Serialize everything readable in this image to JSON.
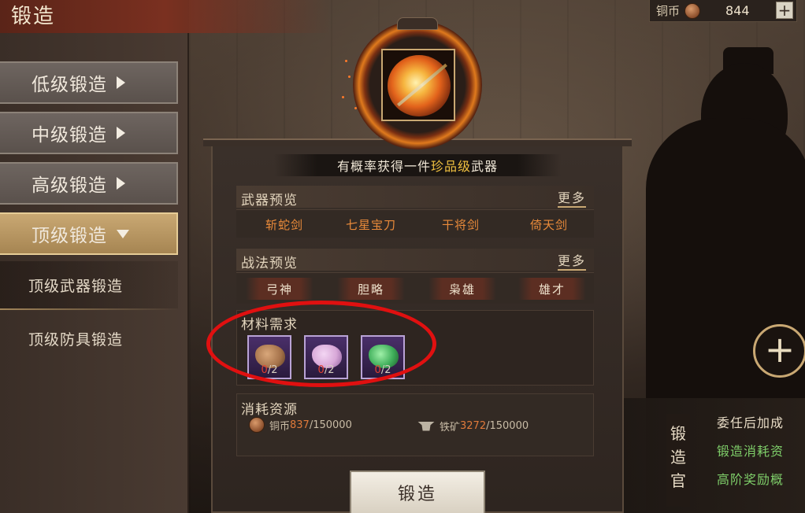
{
  "header": {
    "title": "锻造"
  },
  "currency": {
    "label": "铜币",
    "amount": "844",
    "add_label": "+"
  },
  "sidebar": {
    "items": [
      {
        "label": "低级锻造"
      },
      {
        "label": "中级锻造"
      },
      {
        "label": "高级锻造"
      },
      {
        "label": "顶级锻造",
        "active": true
      }
    ],
    "subitems": [
      {
        "label": "顶级武器锻造",
        "selected": true
      },
      {
        "label": "顶级防具锻造"
      }
    ]
  },
  "banner": {
    "prefix": "有概率获得一件",
    "highlight": "珍品级",
    "suffix": "武器"
  },
  "weapon_preview": {
    "title": "武器预览",
    "more": "更多",
    "items": [
      "斩蛇剑",
      "七星宝刀",
      "干将剑",
      "倚天剑"
    ]
  },
  "strategy_preview": {
    "title": "战法预览",
    "more": "更多",
    "items": [
      "弓神",
      "胆略",
      "枭雄",
      "雄才"
    ]
  },
  "materials": {
    "title": "材料需求",
    "slots": [
      {
        "have": "0",
        "need": "/2",
        "color": "#a5724a",
        "icon": "ore-icon"
      },
      {
        "have": "0",
        "need": "/2",
        "color": "#d8a8d8",
        "icon": "crystal-icon"
      },
      {
        "have": "0",
        "need": "/2",
        "color": "#3fae5a",
        "icon": "jade-icon"
      }
    ]
  },
  "consume": {
    "title": "消耗资源",
    "copper": {
      "label": "铜币",
      "current": "837",
      "total": "/150000"
    },
    "iron": {
      "label": "铁矿",
      "current": "3272",
      "total": "/150000"
    }
  },
  "forge_button": {
    "label": "锻造"
  },
  "officer": {
    "tag_chars": [
      "锻",
      "造",
      "官"
    ],
    "lines": [
      {
        "text": "委任后加成",
        "color": "#e8dcc6"
      },
      {
        "text": "锻造消耗资",
        "color": "#7fcf6a"
      },
      {
        "text": "高阶奖励概",
        "color": "#7fcf6a"
      }
    ],
    "add_label": "+"
  }
}
